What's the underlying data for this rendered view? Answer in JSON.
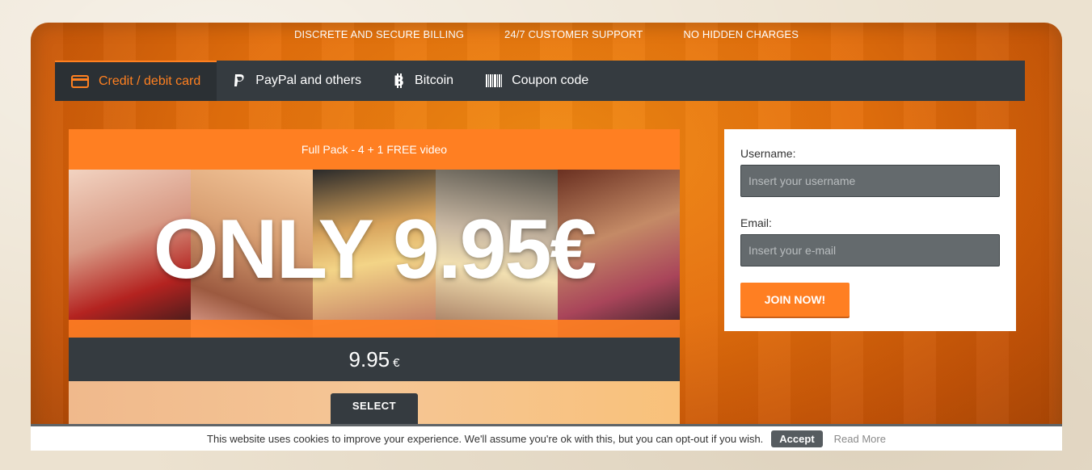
{
  "topbar": {
    "items": [
      "DISCRETE AND SECURE BILLING",
      "24/7 CUSTOMER SUPPORT",
      "NO HIDDEN CHARGES"
    ]
  },
  "tabs": [
    {
      "label": "Credit / debit card",
      "icon": "credit-card-icon",
      "active": true
    },
    {
      "label": "PayPal and others",
      "icon": "paypal-icon",
      "active": false
    },
    {
      "label": "Bitcoin",
      "icon": "bitcoin-icon",
      "active": false
    },
    {
      "label": "Coupon code",
      "icon": "barcode-icon",
      "active": false
    }
  ],
  "offer": {
    "title": "Full Pack - 4 + 1 FREE video",
    "promo_text": "ONLY 9.95€",
    "price": "9.95",
    "currency": "€",
    "select_label": "SELECT"
  },
  "form": {
    "username_label": "Username:",
    "username_placeholder": "Insert your username",
    "email_label": "Email:",
    "email_placeholder": "Insert your e-mail",
    "join_label": "JOIN NOW!"
  },
  "cookie": {
    "message": "This website uses cookies to improve your experience. We'll assume you're ok with this, but you can opt-out if you wish.",
    "accept_label": "Accept",
    "read_more_label": "Read More"
  },
  "colors": {
    "accent": "#ff7f22",
    "dark": "#353b40",
    "background": "#e46f0c"
  }
}
